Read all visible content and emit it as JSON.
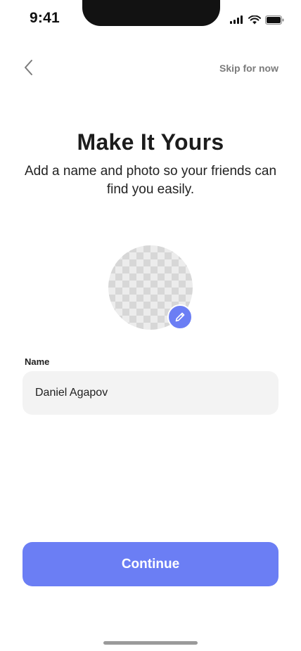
{
  "status_bar": {
    "time": "9:41"
  },
  "nav": {
    "back_icon": "chevron-left-icon",
    "skip_label": "Skip for now"
  },
  "header": {
    "title": "Make It Yours",
    "subtitle": "Add a name and photo so your friends can find you easily."
  },
  "avatar": {
    "placeholder": "transparent-checkerboard",
    "edit_icon": "pencil-icon"
  },
  "form": {
    "name_label": "Name",
    "name_value": "Daniel Agapov"
  },
  "actions": {
    "continue_label": "Continue"
  },
  "colors": {
    "accent": "#6b7ef4",
    "field_bg": "#f3f3f3",
    "muted_text": "#7b7b7b"
  }
}
